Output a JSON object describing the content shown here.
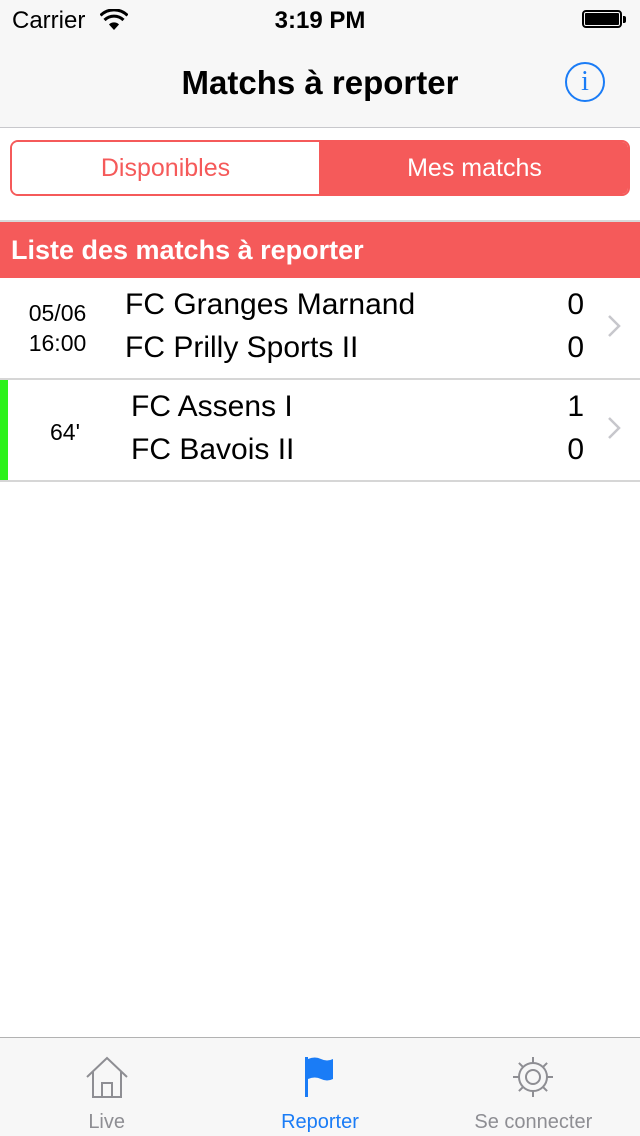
{
  "status_bar": {
    "carrier": "Carrier",
    "time": "3:19 PM"
  },
  "nav": {
    "title": "Matchs à reporter",
    "info_icon": "info-icon"
  },
  "segment": {
    "left_label": "Disponibles",
    "right_label": "Mes matchs",
    "selected": "Mes matchs"
  },
  "section": {
    "title": "Liste des matchs à reporter"
  },
  "matches": [
    {
      "date": "05/06",
      "time": "16:00",
      "home_team": "FC Granges Marnand",
      "away_team": "FC Prilly Sports II",
      "home_score": "0",
      "away_score": "0",
      "live": false
    },
    {
      "minute": "64'",
      "home_team": "FC Assens I",
      "away_team": "FC Bavois II",
      "home_score": "1",
      "away_score": "0",
      "live": true
    }
  ],
  "tabs": [
    {
      "label": "Live",
      "icon": "home-icon",
      "active": false
    },
    {
      "label": "Reporter",
      "icon": "flag-icon",
      "active": true
    },
    {
      "label": "Se connecter",
      "icon": "gear-icon",
      "active": false
    }
  ],
  "colors": {
    "accent": "#f55a5a",
    "tint": "#1a7cf6",
    "live": "#2bf21a",
    "inactive": "#8e8e93"
  }
}
